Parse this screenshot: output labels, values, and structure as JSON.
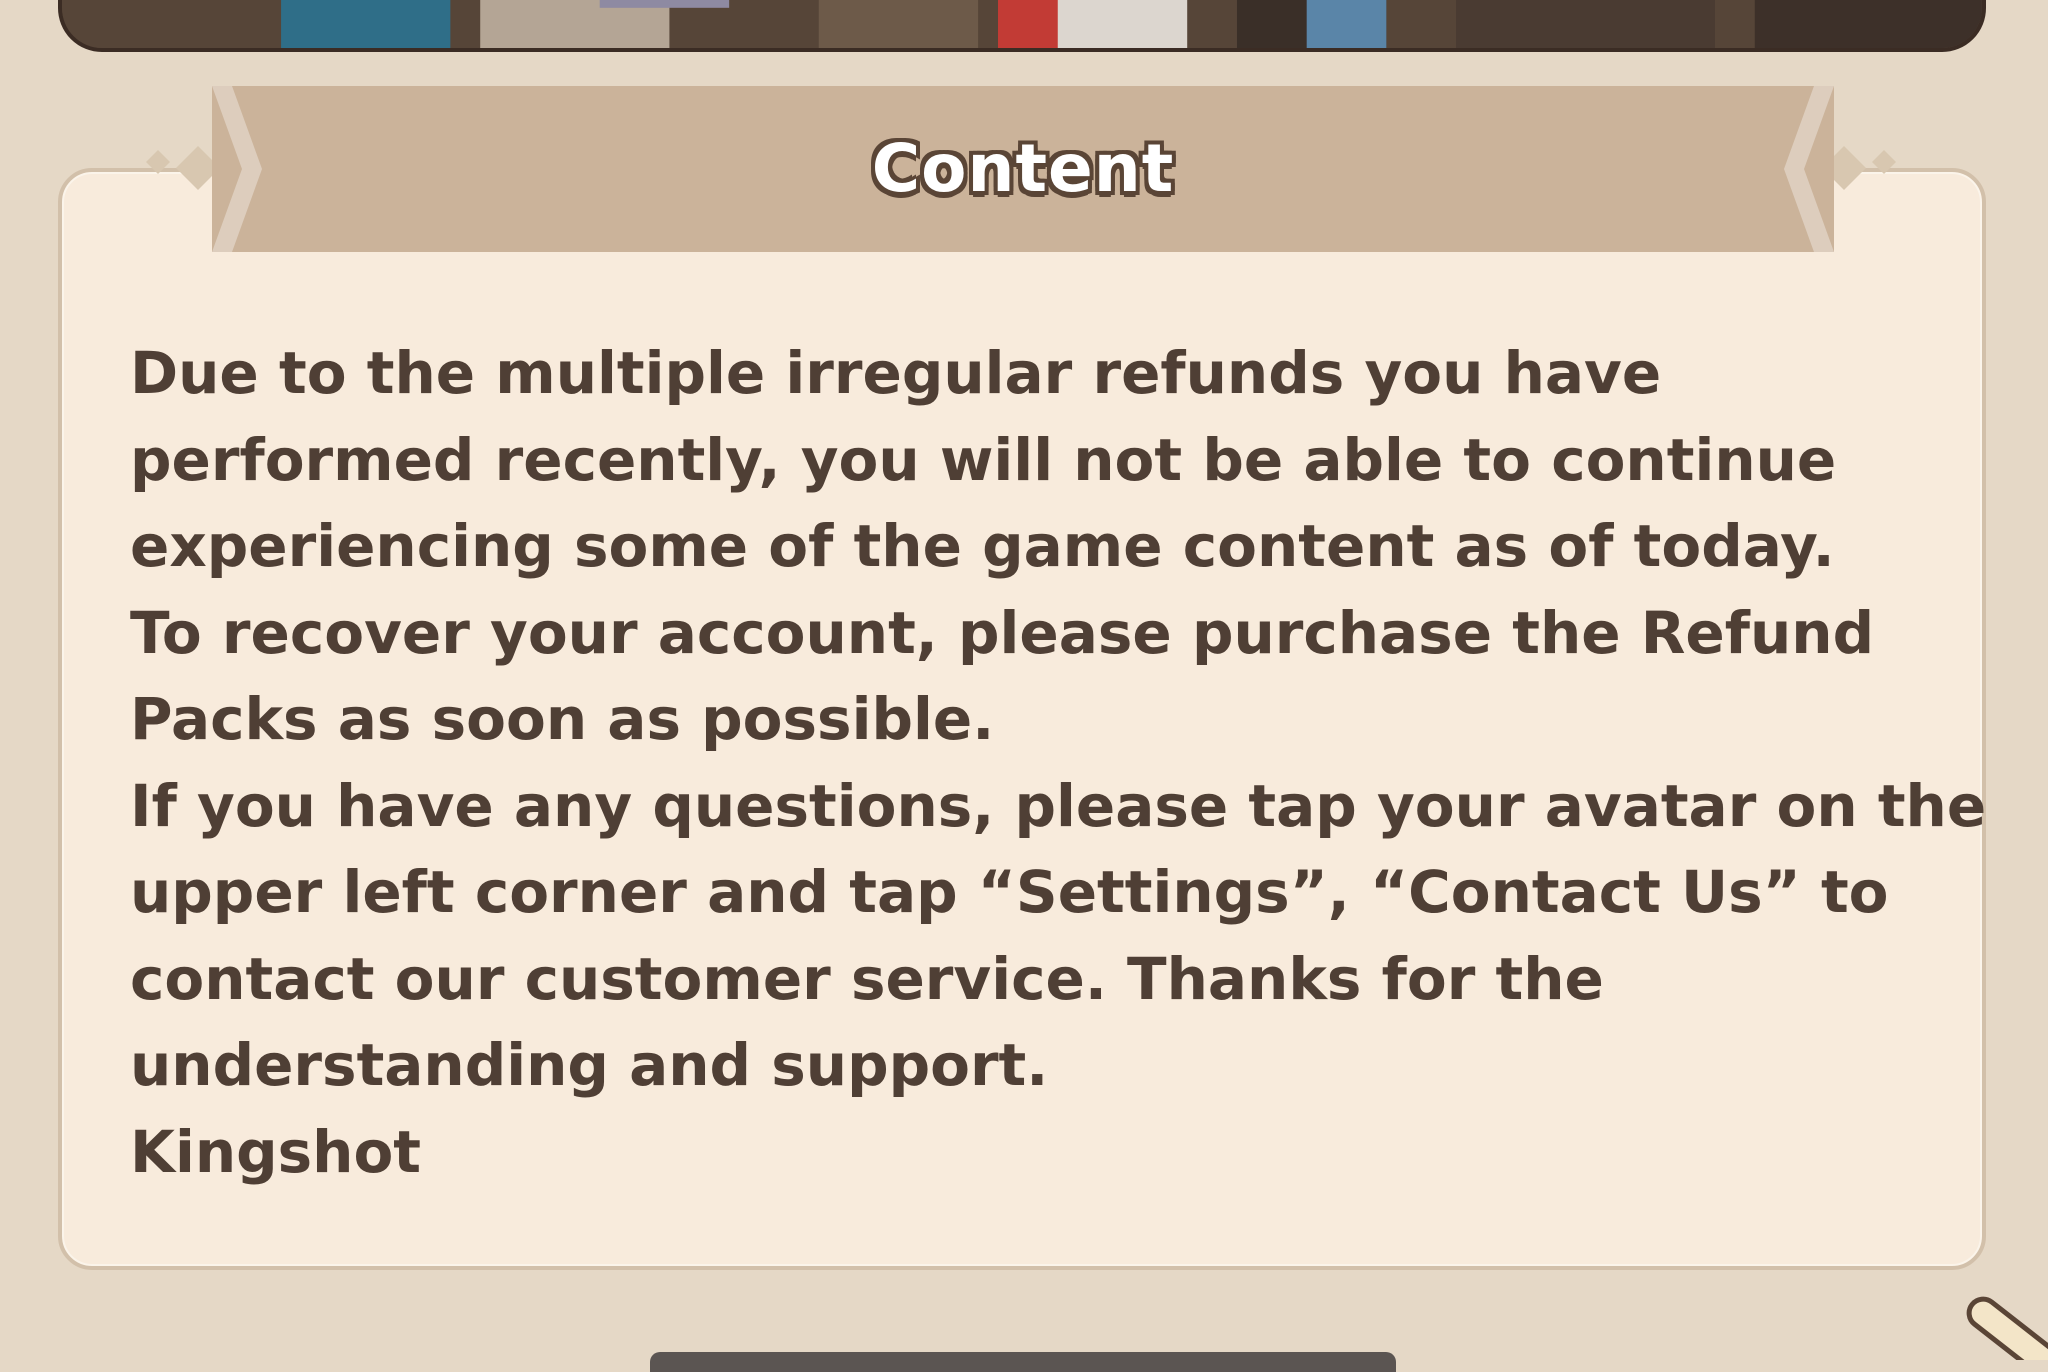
{
  "dialog": {
    "title": "Content",
    "message_lines": [
      "Due to the multiple irregular refunds you have",
      "performed recently, you will not be able to continue",
      "experiencing some of the game content as of today.",
      "To recover your account, please purchase the Refund",
      "Packs as soon as possible.",
      "If you have any questions, please tap your avatar on the",
      "upper left corner and tap “Settings”, “Contact Us” to",
      "contact our customer service. Thanks for the",
      "understanding and support.",
      "Kingshot"
    ]
  },
  "colors": {
    "background": "#e5d8c6",
    "panel_fill": "#f8ebdc",
    "panel_border": "#d2c0aa",
    "header_band": "#cbb39a",
    "text": "#4f3f35",
    "title_text": "#ffffff",
    "title_outline": "#5a4536"
  },
  "icons": {
    "scroll_corner": "scroll-handle-icon"
  }
}
